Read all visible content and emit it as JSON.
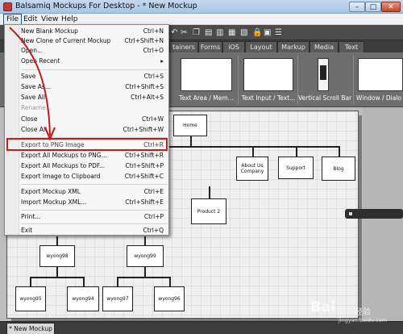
{
  "window": {
    "title": "Balsamiq Mockups For Desktop - * New Mockup",
    "controls": {
      "minimize": "–",
      "maximize": "□",
      "close": "✕"
    }
  },
  "menubar": [
    "File",
    "Edit",
    "View",
    "Help"
  ],
  "toolbar_icons": [
    "undo-icon",
    "redo-icon",
    "cut-icon",
    "copy-icon",
    "paste-icon",
    "delete-icon",
    "group-icon",
    "lock-icon",
    "arrange-icon"
  ],
  "tabs": [
    "tainers",
    "Forms",
    "iOS",
    "Layout",
    "Markup",
    "Media",
    "Text"
  ],
  "components": [
    "Text Area / Mem...",
    "Text Input / Text...",
    "Vertical Scroll Bar",
    "Window / Dialo"
  ],
  "file_menu": {
    "items": [
      {
        "label": "New Blank Mockup",
        "shortcut": "Ctrl+N"
      },
      {
        "label": "New Clone of Current Mockup",
        "shortcut": "Ctrl+Shift+N"
      },
      {
        "label": "Open...",
        "shortcut": "Ctrl+O"
      },
      {
        "label": "Open Recent",
        "shortcut": "▸"
      },
      {
        "label": "Save",
        "shortcut": "Ctrl+S"
      },
      {
        "label": "Save As...",
        "shortcut": "Ctrl+Shift+S"
      },
      {
        "label": "Save All",
        "shortcut": "Ctrl+Alt+S"
      },
      {
        "label": "Rename...",
        "shortcut": ""
      },
      {
        "label": "Close",
        "shortcut": "Ctrl+W"
      },
      {
        "label": "Close All",
        "shortcut": "Ctrl+Shift+W"
      },
      {
        "label": "Export to PNG Image",
        "shortcut": "Ctrl+R"
      },
      {
        "label": "Export All Mockups to PNG...",
        "shortcut": "Ctrl+Shift+R"
      },
      {
        "label": "Export All Mockups to PDF...",
        "shortcut": "Ctrl+Shift+P"
      },
      {
        "label": "Export Image to Clipboard",
        "shortcut": "Ctrl+Shift+C"
      },
      {
        "label": "Export Mockup XML",
        "shortcut": "Ctrl+E"
      },
      {
        "label": "Import Mockup XML...",
        "shortcut": "Ctrl+Shift+E"
      },
      {
        "label": "Print...",
        "shortcut": "Ctrl+P"
      },
      {
        "label": "Exit",
        "shortcut": "Ctrl+Q"
      }
    ]
  },
  "diagram": {
    "nodes": [
      "Home",
      "About Us Company",
      "Support",
      "Blog",
      "Product 2",
      "wyong98",
      "wyong99",
      "wyong95",
      "wyong94",
      "wyong97",
      "wyong96"
    ]
  },
  "doc_tab": "* New Mockup",
  "watermark": {
    "logo": "Bai",
    "suffix": "经验",
    "url": "jingyan.baidu.com"
  },
  "colors": {
    "highlight": "#c21c1c"
  }
}
